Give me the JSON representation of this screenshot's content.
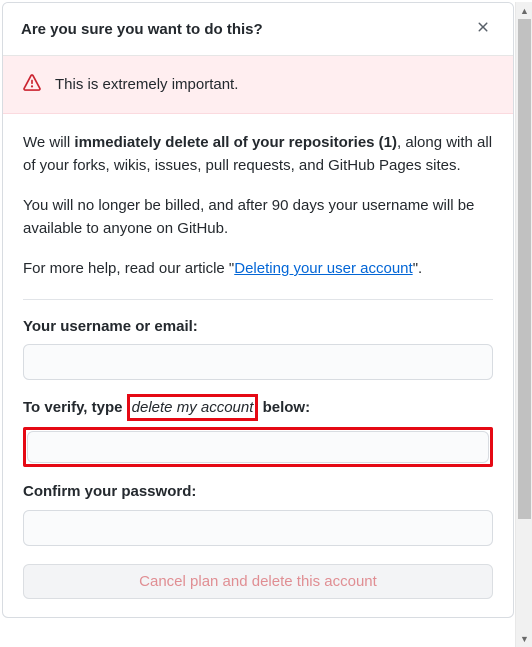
{
  "header": {
    "title": "Are you sure you want to do this?"
  },
  "banner": {
    "text": "This is extremely important."
  },
  "body": {
    "p1_pre": "We will ",
    "p1_bold": "immediately delete all of your repositories (1)",
    "p1_post": ", along with all of your forks, wikis, issues, pull requests, and GitHub Pages sites.",
    "p2": "You will no longer be billed, and after 90 days your username will be available to anyone on GitHub.",
    "p3_pre": "For more help, read our article \"",
    "p3_link": "Deleting your user account",
    "p3_post": "\"."
  },
  "form": {
    "username_label": "Your username or email:",
    "username_value": "",
    "verify_pre": "To verify, type",
    "verify_phrase": "delete my account",
    "verify_post": "below:",
    "verify_value": "",
    "password_label": "Confirm your password:",
    "password_value": "",
    "submit_label": "Cancel plan and delete this account"
  }
}
